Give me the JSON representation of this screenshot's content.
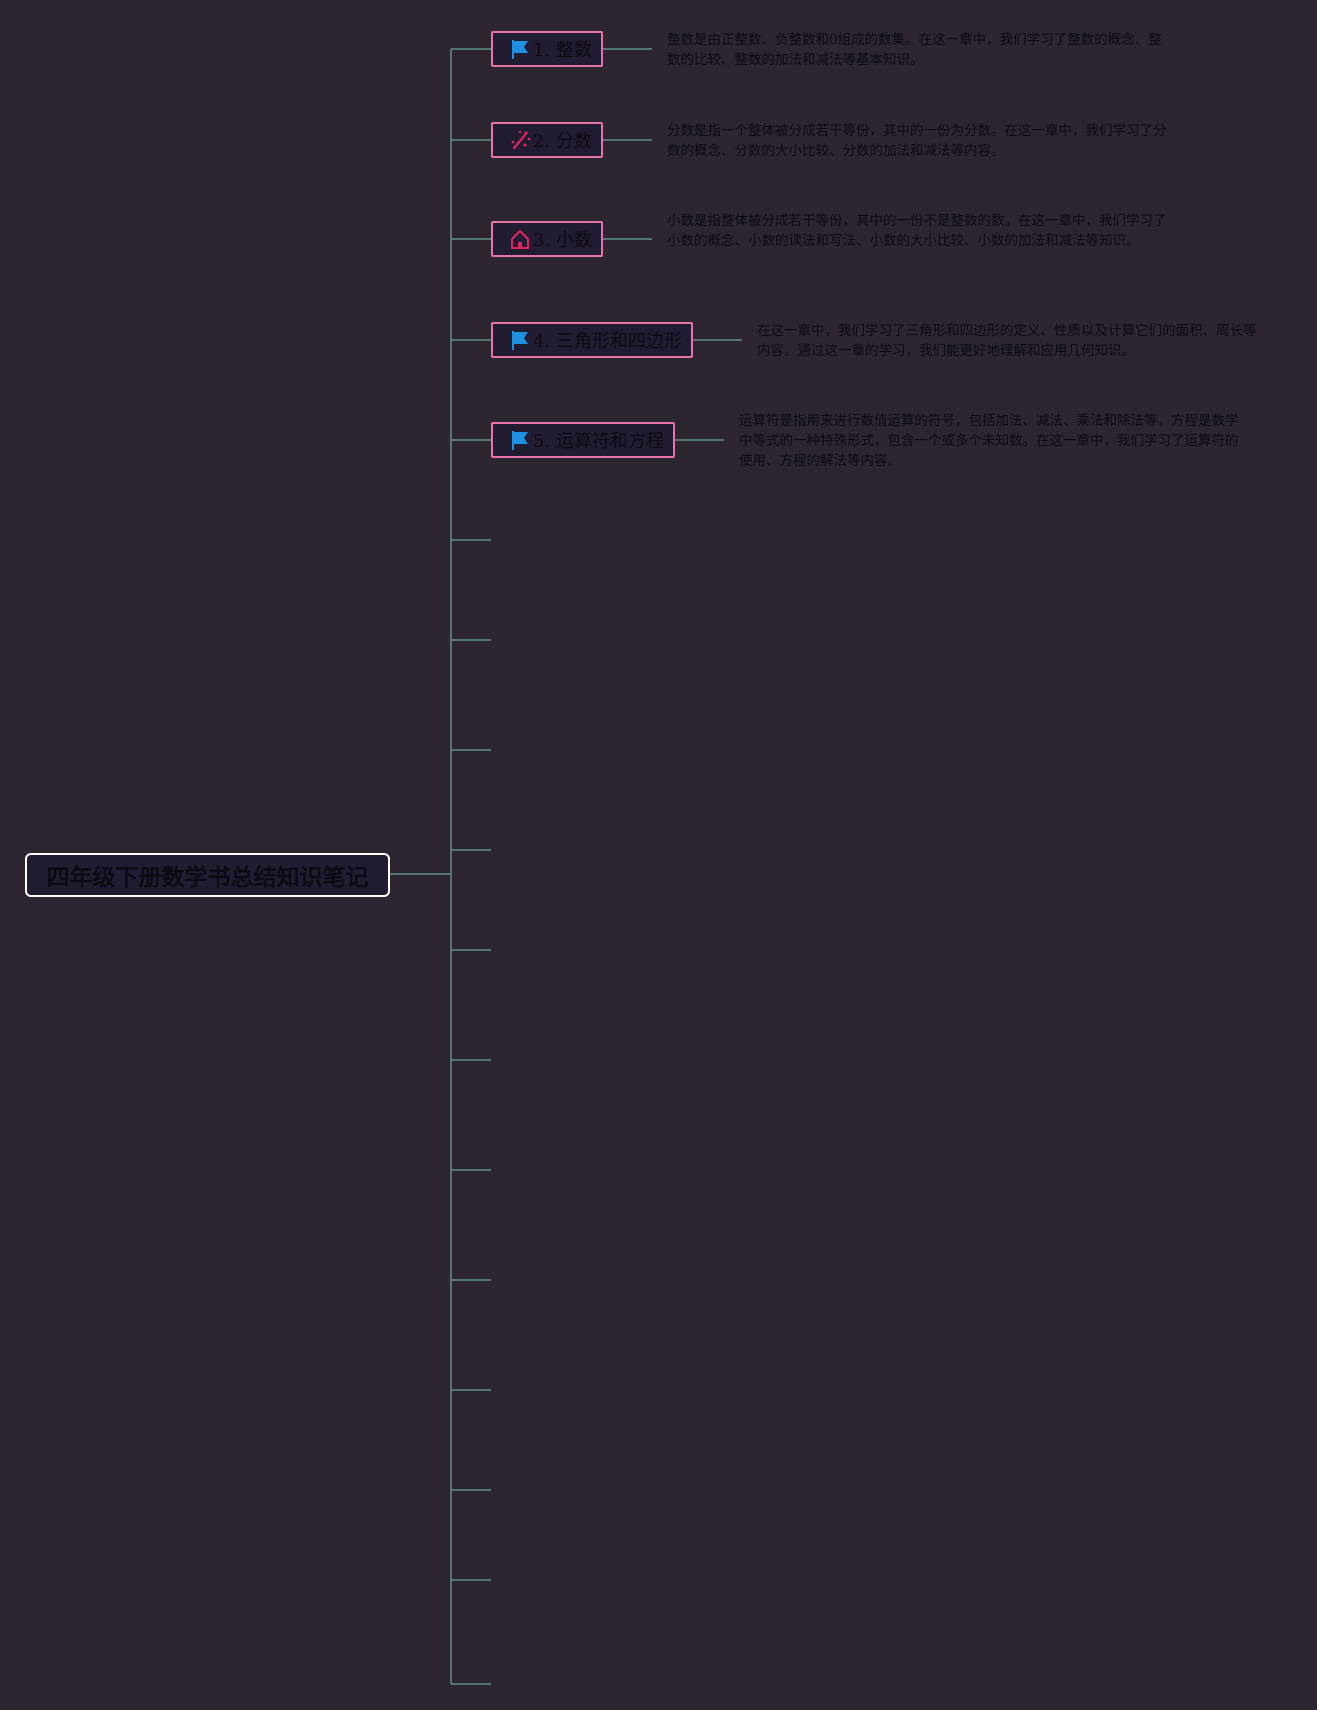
{
  "root": {
    "title": "四年级下册数学书总结知识笔记"
  },
  "topics": [
    {
      "label": "1. 整数",
      "icon": "flag-icon",
      "note": "整数是由正整数、负整数和0组成的数集。在这一章中，我们学习了整数的概念、整数的比较、整数的加法和减法等基本知识。"
    },
    {
      "label": "2. 分数",
      "icon": "magic-wand-icon",
      "note": "分数是指一个整体被分成若干等份，其中的一份为分数。在这一章中，我们学习了分数的概念、分数的大小比较、分数的加法和减法等内容。"
    },
    {
      "label": "3. 小数",
      "icon": "home-icon",
      "note": "小数是指整体被分成若干等份，其中的一份不是整数的数。在这一章中，我们学习了小数的概念、小数的读法和写法、小数的大小比较、小数的加法和减法等知识。"
    },
    {
      "label": "4. 三角形和四边形",
      "icon": "flag-icon",
      "note": "在这一章中，我们学习了三角形和四边形的定义、性质以及计算它们的面积、周长等内容。通过这一章的学习，我们能更好地理解和应用几何知识。"
    },
    {
      "label": "5. 运算符和方程",
      "icon": "flag-icon",
      "note": "运算符是指用来进行数值运算的符号，包括加法、减法、乘法和除法等。方程是数学中等式的一种特殊形式，包含一个或多个未知数。在这一章中，我们学习了运算符的使用、方程的解法等内容。"
    }
  ],
  "colors": {
    "background": "#2d2630",
    "connector": "#5e8f8a",
    "topic_border": "#e774a9",
    "node_fill": "#221c33",
    "flag_icon": "#1f8fe0",
    "accent_icon": "#e0245e"
  }
}
